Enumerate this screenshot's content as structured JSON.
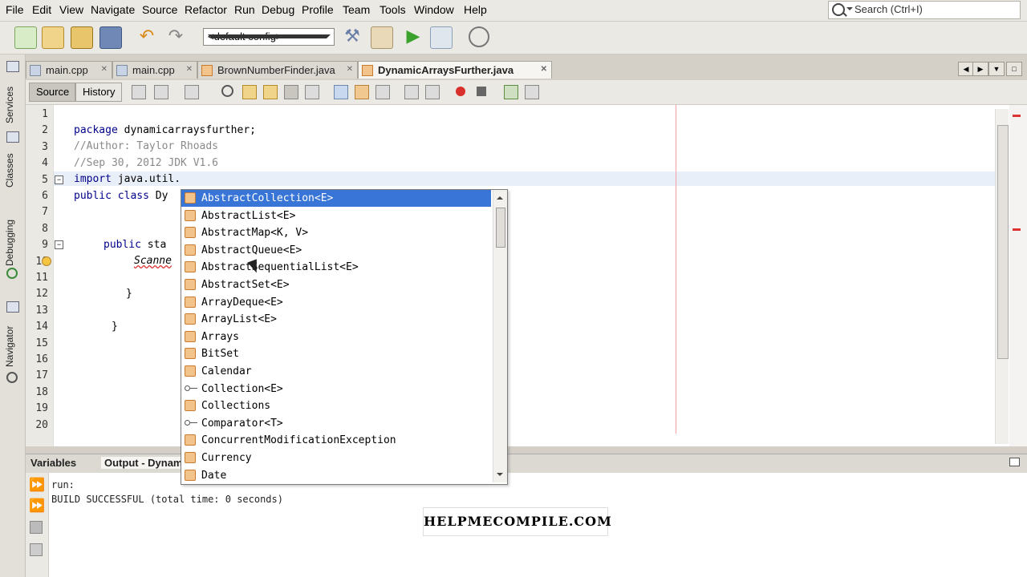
{
  "menu": [
    "File",
    "Edit",
    "View",
    "Navigate",
    "Source",
    "Refactor",
    "Run",
    "Debug",
    "Profile",
    "Team",
    "Tools",
    "Window",
    "Help"
  ],
  "search": {
    "placeholder": "Search (Ctrl+I)"
  },
  "toolbar": {
    "config": "<default config>"
  },
  "left_strip": [
    "Services",
    "Classes",
    "Debugging",
    "Navigator"
  ],
  "tabs": [
    "main.cpp",
    "main.cpp",
    "BrownNumberFinder.java",
    "DynamicArraysFurther.java"
  ],
  "editor_toolbar": {
    "source": "Source",
    "history": "History"
  },
  "lines": [
    "1",
    "2",
    "3",
    "4",
    "5",
    "6",
    "7",
    "8",
    "9",
    "10",
    "11",
    "12",
    "13",
    "14",
    "15",
    "16",
    "17",
    "18",
    "19",
    "20"
  ],
  "code": {
    "l2_kw": "package",
    "l2_rest": " dynamicarraysfurther;",
    "l3": "//Author: Taylor Rhoads",
    "l4": "//Sep 30, 2012 JDK V1.6",
    "l5_kw": "import",
    "l5_rest": " java.util.",
    "l6_kw": "public class",
    "l6_rest": " Dy",
    "l9_kw": "public",
    "l9_rest": " sta",
    "l10": "Scanne",
    "l12": "}",
    "l14": "}"
  },
  "completion": {
    "items": [
      {
        "label": "AbstractCollection<E>",
        "kind": "class",
        "selected": true
      },
      {
        "label": "AbstractList<E>",
        "kind": "class"
      },
      {
        "label": "AbstractMap<K, V>",
        "kind": "class"
      },
      {
        "label": "AbstractQueue<E>",
        "kind": "class"
      },
      {
        "label": "AbstractSequentialList<E>",
        "kind": "class"
      },
      {
        "label": "AbstractSet<E>",
        "kind": "class"
      },
      {
        "label": "ArrayDeque<E>",
        "kind": "class"
      },
      {
        "label": "ArrayList<E>",
        "kind": "class"
      },
      {
        "label": "Arrays",
        "kind": "class"
      },
      {
        "label": "BitSet",
        "kind": "class"
      },
      {
        "label": "Calendar",
        "kind": "class"
      },
      {
        "label": "Collection<E>",
        "kind": "interface"
      },
      {
        "label": "Collections",
        "kind": "class"
      },
      {
        "label": "Comparator<T>",
        "kind": "interface"
      },
      {
        "label": "ConcurrentModificationException",
        "kind": "class"
      },
      {
        "label": "Currency",
        "kind": "class"
      },
      {
        "label": "Date",
        "kind": "class"
      }
    ]
  },
  "bottom": {
    "tab_variables": "Variables",
    "tab_output": "Output - Dynam"
  },
  "output": [
    "run:",
    "BUILD SUCCESSFUL (total time: 0 seconds)"
  ],
  "watermark": "HELPMECOMPILE.COM",
  "colors": {
    "selection": "#3875d7",
    "keyword": "#00008b",
    "comment": "#8a8a8a",
    "margin_line": "#f2a0a0"
  }
}
